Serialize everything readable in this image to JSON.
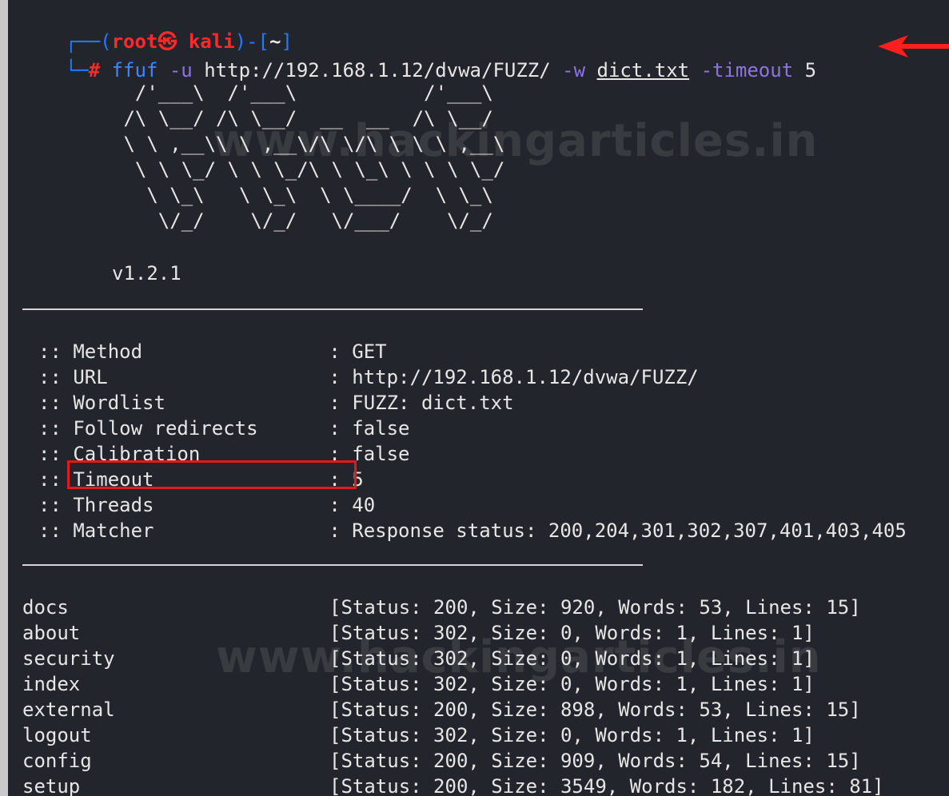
{
  "prompt": {
    "open": "┌──(",
    "user": "root",
    "sep": "㉿",
    "host": "kali",
    "mid": ")-[",
    "dir": "~",
    "close": "]",
    "corner": "└─",
    "hash": "#"
  },
  "command": {
    "tool": "ffuf",
    "flag_u": "-u",
    "url": "http://192.168.1.12/dvwa/FUZZ/",
    "flag_w": "-w",
    "wordlist": "dict.txt",
    "flag_timeout": "-timeout",
    "timeout_val": "5"
  },
  "ascii_art": "  /'___\\  /'___\\           /'___\\\n /\\ \\__/ /\\ \\__/  __  __  /\\ \\__/\n \\ \\ ,__\\\\ \\ ,__\\/\\ \\/\\ \\ \\ \\ ,__\\\n  \\ \\ \\_/ \\ \\ \\_/\\ \\ \\_\\ \\ \\ \\ \\_/\n   \\ \\_\\   \\ \\_\\  \\ \\____/  \\ \\_\\\n    \\/_/    \\/_/   \\/___/    \\/_/",
  "version": "v1.2.1",
  "info": [
    {
      "prefix": "::",
      "key": "Method",
      "value": ": GET"
    },
    {
      "prefix": "::",
      "key": "URL",
      "value": ": http://192.168.1.12/dvwa/FUZZ/"
    },
    {
      "prefix": "::",
      "key": "Wordlist",
      "value": ": FUZZ: dict.txt"
    },
    {
      "prefix": "::",
      "key": "Follow redirects",
      "value": ": false"
    },
    {
      "prefix": "::",
      "key": "Calibration",
      "value": ": false"
    },
    {
      "prefix": "::",
      "key": "Timeout",
      "value": ": 5"
    },
    {
      "prefix": "::",
      "key": "Threads",
      "value": ": 40"
    },
    {
      "prefix": "::",
      "key": "Matcher",
      "value": ": Response status: 200,204,301,302,307,401,403,405"
    }
  ],
  "results": [
    {
      "name": "docs",
      "detail": "[Status: 200, Size: 920, Words: 53, Lines: 15]"
    },
    {
      "name": "about",
      "detail": "[Status: 302, Size: 0, Words: 1, Lines: 1]"
    },
    {
      "name": "security",
      "detail": "[Status: 302, Size: 0, Words: 1, Lines: 1]"
    },
    {
      "name": "index",
      "detail": "[Status: 302, Size: 0, Words: 1, Lines: 1]"
    },
    {
      "name": "external",
      "detail": "[Status: 200, Size: 898, Words: 53, Lines: 15]"
    },
    {
      "name": "logout",
      "detail": "[Status: 302, Size: 0, Words: 1, Lines: 1]"
    },
    {
      "name": "config",
      "detail": "[Status: 200, Size: 909, Words: 54, Lines: 15]"
    },
    {
      "name": "setup",
      "detail": "[Status: 200, Size: 3549, Words: 182, Lines: 81]"
    }
  ],
  "watermark": "www.hackingarticles.in",
  "colors": {
    "background": "#22252b",
    "prompt_blue": "#1f7cff",
    "root_red": "#ff2a2a",
    "flag_purple": "#8f73e6",
    "highlight_red": "#e0191d"
  }
}
